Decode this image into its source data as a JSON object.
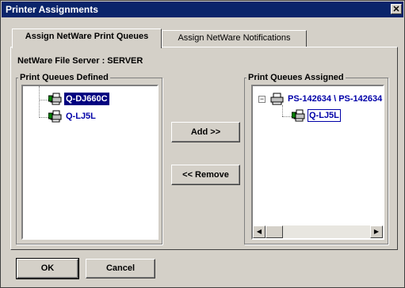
{
  "window": {
    "title": "Printer Assignments",
    "close_label": "✕"
  },
  "tabs": [
    {
      "label": "Assign NetWare Print Queues",
      "active": true
    },
    {
      "label": "Assign NetWare Notifications",
      "active": false
    }
  ],
  "file_server": {
    "label": "NetWare File Server : SERVER"
  },
  "defined": {
    "label": "Print Queues Defined",
    "items": [
      {
        "label": "Q-DJ660C",
        "selected": true
      },
      {
        "label": "Q-LJ5L",
        "selected": false
      }
    ]
  },
  "assigned": {
    "label": "Print Queues Assigned",
    "root": {
      "label": "PS-142634 \\ PS-142634",
      "expander": "−"
    },
    "children": [
      {
        "label": "Q-LJ5L"
      }
    ]
  },
  "actions": {
    "add_label": "Add >>",
    "remove_label": "<< Remove"
  },
  "footer": {
    "ok_label": "OK",
    "cancel_label": "Cancel"
  },
  "scroll": {
    "left_arrow": "◀",
    "right_arrow": "▶"
  },
  "colors": {
    "titlebar": "#0a246a",
    "item_text": "#0000a8",
    "selected_bg": "#000080",
    "face": "#d4d0c8"
  },
  "icons": {
    "queue_item": "printer-queue-icon",
    "server": "print-server-icon"
  }
}
